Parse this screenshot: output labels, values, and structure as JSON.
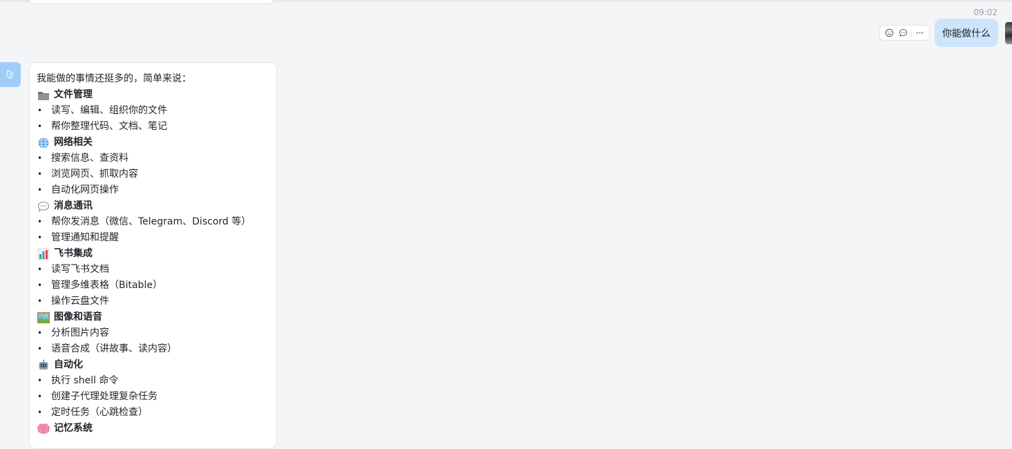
{
  "timestamp": "09:02",
  "user_message": "你能做什么",
  "actions": {
    "react_icon": "add-reaction-icon",
    "reply_icon": "comment-icon",
    "more_icon": "more-horizontal-icon"
  },
  "bot": {
    "intro": "我能做的事情还挺多的，简单来说：",
    "sections": [
      {
        "emoji": "folder",
        "title": "文件管理",
        "items": [
          "读写、编辑、组织你的文件",
          "帮你整理代码、文档、笔记"
        ]
      },
      {
        "emoji": "globe",
        "title": "网络相关",
        "items": [
          "搜索信息、查资料",
          "浏览网页、抓取内容",
          "自动化网页操作"
        ]
      },
      {
        "emoji": "speech",
        "title": "消息通讯",
        "items": [
          "帮你发消息（微信、Telegram、Discord 等）",
          "管理通知和提醒"
        ]
      },
      {
        "emoji": "chart",
        "title": "飞书集成",
        "items": [
          "读写飞书文档",
          "管理多维表格（Bitable）",
          "操作云盘文件"
        ]
      },
      {
        "emoji": "picture",
        "title": "图像和语音",
        "items": [
          "分析图片内容",
          "语音合成（讲故事、读内容）"
        ]
      },
      {
        "emoji": "robot",
        "title": "自动化",
        "items": [
          "执行 shell 命令",
          "创建子代理处理复杂任务",
          "定时任务（心跳检查）"
        ]
      },
      {
        "emoji": "brain",
        "title": "记忆系统",
        "items": []
      }
    ]
  },
  "colors": {
    "user_bubble": "#cde4fb",
    "bot_avatar": "#9fcdf7",
    "background": "#f4f5f6"
  }
}
